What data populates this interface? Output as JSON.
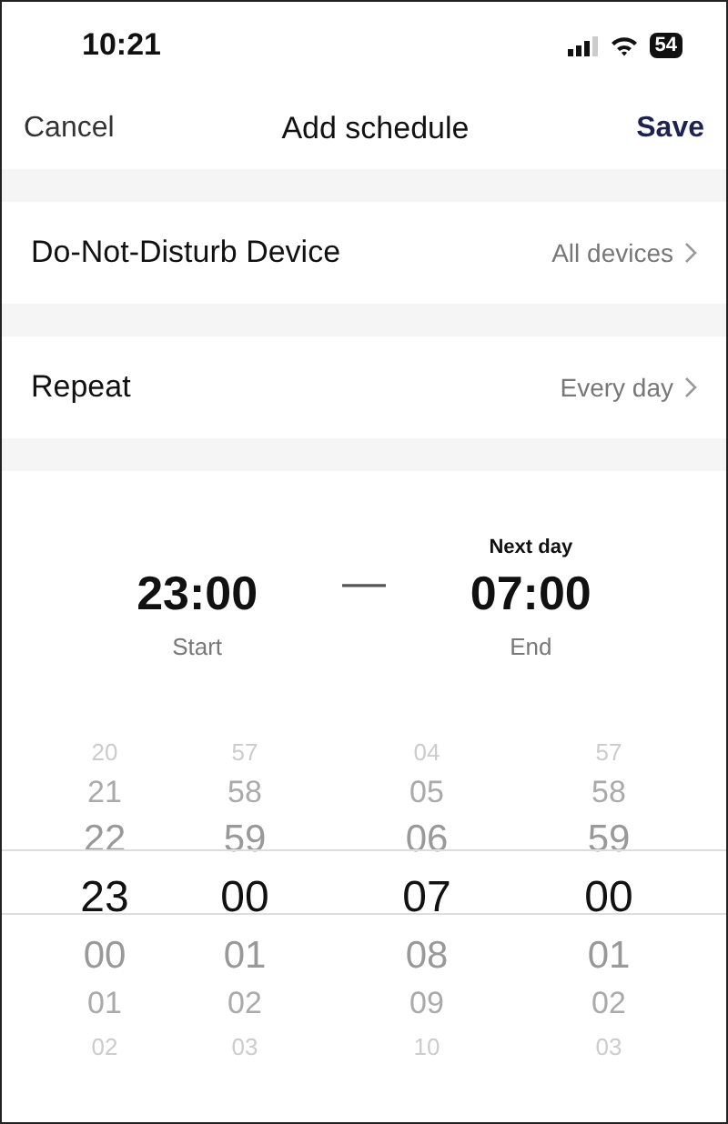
{
  "status_bar": {
    "time": "10:21",
    "battery": "54"
  },
  "nav": {
    "cancel": "Cancel",
    "title": "Add schedule",
    "save": "Save"
  },
  "settings": [
    {
      "label": "Do-Not-Disturb Device",
      "value": "All devices"
    },
    {
      "label": "Repeat",
      "value": "Every day"
    }
  ],
  "range": {
    "start": {
      "time": "23:00",
      "caption": "Start"
    },
    "separator": "—",
    "end": {
      "note": "Next day",
      "time": "07:00",
      "caption": "End"
    }
  },
  "pickers": [
    {
      "values": [
        {
          "text": "20",
          "selected": false
        },
        {
          "text": "21",
          "selected": false
        },
        {
          "text": "22",
          "selected": false
        },
        {
          "text": "23",
          "selected": true
        },
        {
          "text": "00",
          "selected": false
        },
        {
          "text": "01",
          "selected": false
        },
        {
          "text": "02",
          "selected": false
        }
      ]
    },
    {
      "values": [
        {
          "text": "57",
          "selected": false
        },
        {
          "text": "58",
          "selected": false
        },
        {
          "text": "59",
          "selected": false
        },
        {
          "text": "00",
          "selected": true
        },
        {
          "text": "01",
          "selected": false
        },
        {
          "text": "02",
          "selected": false
        },
        {
          "text": "03",
          "selected": false
        }
      ]
    },
    {
      "values": [
        {
          "text": "04",
          "selected": false
        },
        {
          "text": "05",
          "selected": false
        },
        {
          "text": "06",
          "selected": false
        },
        {
          "text": "07",
          "selected": true
        },
        {
          "text": "08",
          "selected": false
        },
        {
          "text": "09",
          "selected": false
        },
        {
          "text": "10",
          "selected": false
        }
      ]
    },
    {
      "values": [
        {
          "text": "57",
          "selected": false
        },
        {
          "text": "58",
          "selected": false
        },
        {
          "text": "59",
          "selected": false
        },
        {
          "text": "00",
          "selected": true
        },
        {
          "text": "01",
          "selected": false
        },
        {
          "text": "02",
          "selected": false
        },
        {
          "text": "03",
          "selected": false
        }
      ]
    }
  ]
}
